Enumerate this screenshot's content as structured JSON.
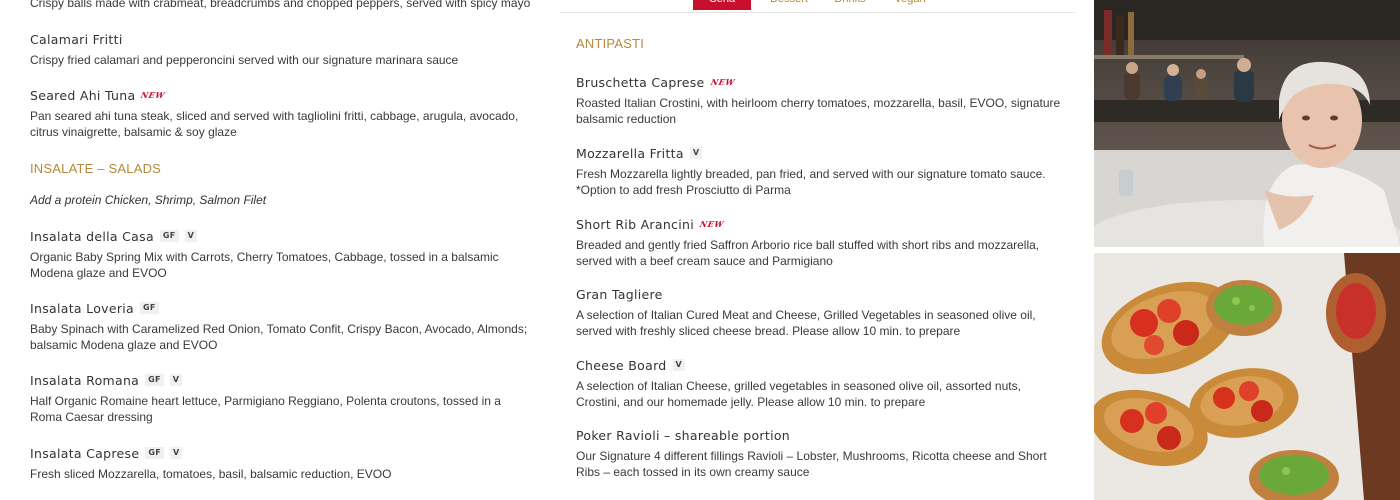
{
  "menu": {
    "tabs": [
      {
        "label": "Cena",
        "active": true
      },
      {
        "label": "Dessert",
        "active": false
      },
      {
        "label": "Drinks",
        "active": false
      },
      {
        "label": "Vegan",
        "active": false
      }
    ],
    "cut_off_description": "Crispy balls made with crabmeat, breadcrumbs and chopped peppers, served with spicy mayo",
    "left_items": [
      {
        "name": "Calamari Fritti",
        "desc": "Crispy fried calamari and pepperoncini served with our signature marinara sauce"
      },
      {
        "name": "Seared Ahi Tuna",
        "badge": "NEW",
        "desc": "Pan seared ahi tuna steak, sliced and served with tagliolini fritti, cabbage, arugula, avocado, citrus vinaigrette, balsamic & soy glaze"
      }
    ],
    "salads_section": {
      "title": "INSALATE – SALADS",
      "note": "Add a protein Chicken, Shrimp, Salmon Filet",
      "items": [
        {
          "name": "Insalata della Casa",
          "tags": [
            "GF",
            "V"
          ],
          "desc": "Organic Baby Spring Mix with Carrots, Cherry Tomatoes, Cabbage, tossed in a balsamic Modena glaze and EVOO"
        },
        {
          "name": "Insalata Loveria",
          "tags": [
            "GF"
          ],
          "desc": "Baby Spinach with Caramelized Red Onion, Tomato Confit, Crispy Bacon, Avocado, Almonds; balsamic Modena glaze and EVOO"
        },
        {
          "name": "Insalata Romana",
          "tags": [
            "GF",
            "V"
          ],
          "desc": "Half Organic Romaine heart lettuce, Parmigiano Reggiano, Polenta croutons, tossed in a Roma Caesar dressing"
        },
        {
          "name": "Insalata Caprese",
          "tags": [
            "GF",
            "V"
          ],
          "desc": "Fresh sliced Mozzarella, tomatoes, basil, balsamic reduction, EVOO"
        }
      ]
    },
    "antipasti_section": {
      "title": "ANTIPASTI",
      "items": [
        {
          "name": "Bruschetta Caprese",
          "badge": "NEW",
          "desc": "Roasted Italian Crostini, with heirloom cherry tomatoes, mozzarella, basil, EVOO, signature balsamic reduction"
        },
        {
          "name": "Mozzarella Fritta",
          "tags": [
            "V"
          ],
          "desc": "Fresh Mozzarella lightly breaded, pan fried, and served with our signature tomato sauce. *Option to add fresh Prosciutto di Parma"
        },
        {
          "name": "Short Rib Arancini",
          "badge": "NEW",
          "desc": "Breaded and gently fried Saffron Arborio rice ball stuffed with short ribs and mozzarella, served with a beef cream sauce and Parmigiano"
        },
        {
          "name": "Gran Tagliere",
          "desc": "A selection of Italian Cured Meat and Cheese, Grilled Vegetables in seasoned olive oil, served with freshly sliced cheese bread. Please allow 10 min. to prepare"
        },
        {
          "name": "Cheese Board",
          "tags": [
            "V"
          ],
          "desc": "A selection of Italian Cheese, grilled vegetables in seasoned olive oil, assorted nuts, Crostini, and our homemade jelly. Please allow 10 min. to prepare"
        },
        {
          "name": "Poker Ravioli – shareable portion",
          "desc": "Our Signature 4 different fillings Ravioli – Lobster, Mushrooms, Ricotta cheese and Short Ribs – each tossed in its own creamy sauce"
        }
      ]
    }
  },
  "colors": {
    "section_title": "#b5893a",
    "new_badge": "#c8102e",
    "active_tab": "#c8102e"
  },
  "photos": [
    {
      "subject": "restaurant-guest-photo"
    },
    {
      "subject": "bruschetta-dish-photo"
    }
  ]
}
